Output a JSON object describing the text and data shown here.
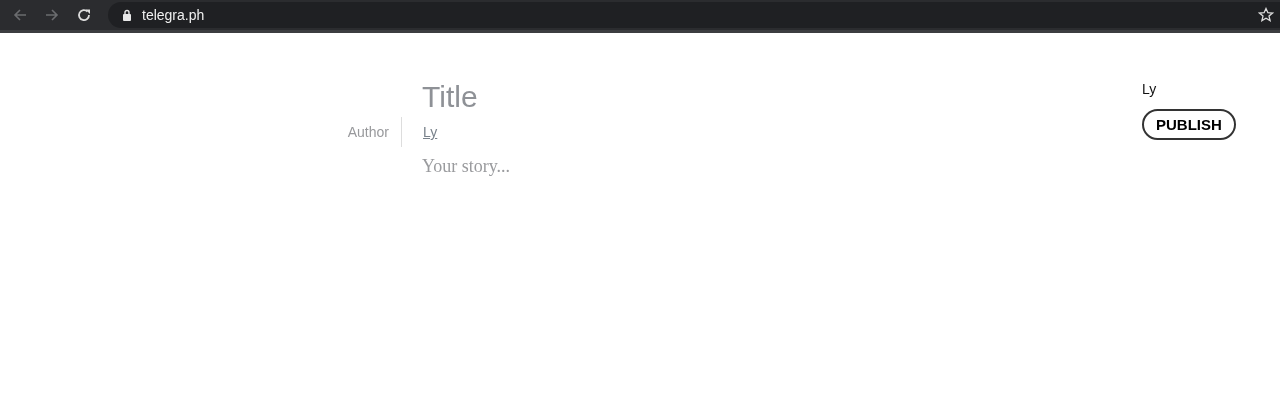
{
  "browser": {
    "url": "telegra.ph"
  },
  "editor": {
    "title": {
      "placeholder": "Title"
    },
    "author_label": "Author",
    "author": {
      "value": "Ly"
    },
    "story": {
      "placeholder": "Your story..."
    }
  },
  "account": {
    "name": "Ly",
    "publish_button": "PUBLISH"
  }
}
